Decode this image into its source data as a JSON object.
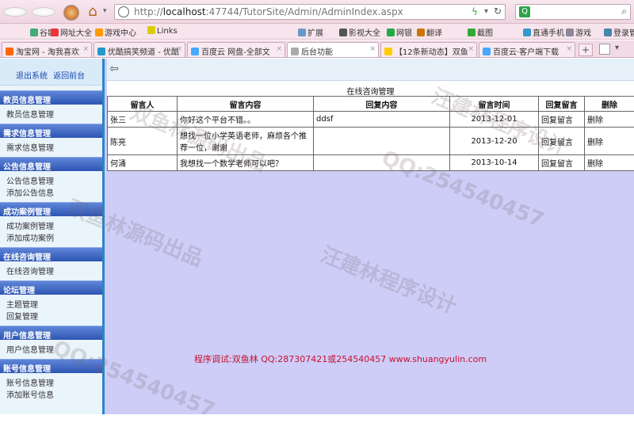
{
  "browser": {
    "url_prefix": "http://",
    "url_host": "localhost",
    "url_rest": ":47744/TutorSite/Admin/AdminIndex.aspx",
    "bookmarks": [
      "谷歌",
      "网址大全",
      "游戏中心",
      "Links",
      "扩展",
      "影视大全",
      "网银",
      "翻译",
      "截图",
      "直通手机",
      "游戏",
      "登录管"
    ],
    "tabs": [
      "淘宝网 - 淘我喜欢",
      "优酷搞笑频道 - 优酷",
      "百度云 网盘-全部文",
      "后台功能",
      "【12条新动态】双鱼",
      "百度云·客户端下载"
    ],
    "active_tab": 3
  },
  "sidebar": {
    "logout": "退出系统",
    "home": "返回前台",
    "sections": [
      {
        "title": "教员信息管理",
        "items": [
          "教员信息管理"
        ]
      },
      {
        "title": "需求信息管理",
        "items": [
          "需求信息管理"
        ]
      },
      {
        "title": "公告信息管理",
        "items": [
          "公告信息管理",
          "添加公告信息"
        ]
      },
      {
        "title": "成功案例管理",
        "items": [
          "成功案例管理",
          "添加成功案例"
        ]
      },
      {
        "title": "在线咨询管理",
        "items": [
          "在线咨询管理"
        ]
      },
      {
        "title": "论坛管理",
        "items": [
          "主题管理",
          "回复管理"
        ]
      },
      {
        "title": "用户信息管理",
        "items": [
          "用户信息管理"
        ]
      },
      {
        "title": "账号信息管理",
        "items": [
          "账号信息管理",
          "添加账号信息"
        ]
      }
    ]
  },
  "main": {
    "title": "在线咨询管理",
    "columns": [
      "留言人",
      "留言内容",
      "回复内容",
      "留言时间",
      "回复留言",
      "删除"
    ],
    "rows": [
      {
        "name": "张三",
        "content": "你好这个平台不错。。",
        "reply": "ddsf",
        "time": "2013-12-01",
        "reply_link": "回复留言",
        "delete_link": "删除"
      },
      {
        "name": "陈亮",
        "content": "想找一位小学英语老师，麻烦各个推荐一位，谢谢",
        "reply": "",
        "time": "2013-12-20",
        "reply_link": "回复留言",
        "delete_link": "删除"
      },
      {
        "name": "何涌",
        "content": "我想找一个数学老师可以吧？",
        "reply": "",
        "time": "2013-10-14",
        "reply_link": "回复留言",
        "delete_link": "删除"
      }
    ],
    "footer": "程序调试:双鱼林 QQ:287307421或254540457 www.shuangyulin.com"
  },
  "watermarks": [
    "QQ:254540457",
    "双鱼林源码出品",
    "汪建林程序设计"
  ]
}
